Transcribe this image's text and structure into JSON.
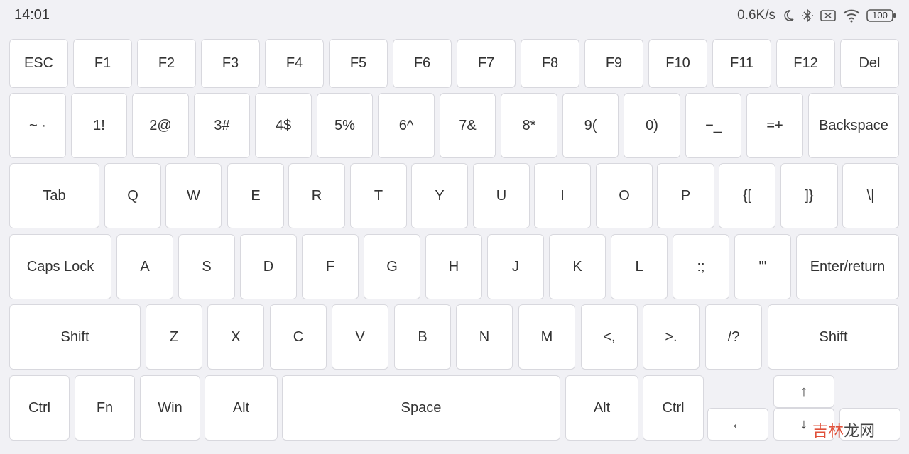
{
  "status_bar": {
    "time": "14:01",
    "network_speed": "0.6K/s",
    "battery": "100",
    "icons": [
      "moon-icon",
      "bluetooth-icon",
      "sim-off-icon",
      "wifi-icon",
      "battery-icon"
    ]
  },
  "keyboard": {
    "row1": [
      "ESC",
      "F1",
      "F2",
      "F3",
      "F4",
      "F5",
      "F6",
      "F7",
      "F8",
      "F9",
      "F10",
      "F11",
      "F12",
      "Del"
    ],
    "row2": [
      "~ ·",
      "1!",
      "2@",
      "3#",
      "4$",
      "5%",
      "6^",
      "7&",
      "8*",
      "9(",
      "0)",
      "−_",
      "=+",
      "Backspace"
    ],
    "row3": [
      "Tab",
      "Q",
      "W",
      "E",
      "R",
      "T",
      "Y",
      "U",
      "I",
      "O",
      "P",
      "{[",
      "]}",
      "\\|"
    ],
    "row4": [
      "Caps Lock",
      "A",
      "S",
      "D",
      "F",
      "G",
      "H",
      "J",
      "K",
      "L",
      ":;",
      "\"'",
      "Enter/return"
    ],
    "row5": [
      "Shift",
      "Z",
      "X",
      "C",
      "V",
      "B",
      "N",
      "M",
      "<,",
      ">.",
      "/?",
      "Shift"
    ],
    "row6": [
      "Ctrl",
      "Fn",
      "Win",
      "Alt",
      "Space",
      "Alt",
      "Ctrl"
    ],
    "arrows": {
      "up": "↑",
      "left": "←",
      "down": "↓",
      "right": ""
    }
  },
  "watermark": {
    "part1": "吉林",
    "part2": "龙网"
  }
}
